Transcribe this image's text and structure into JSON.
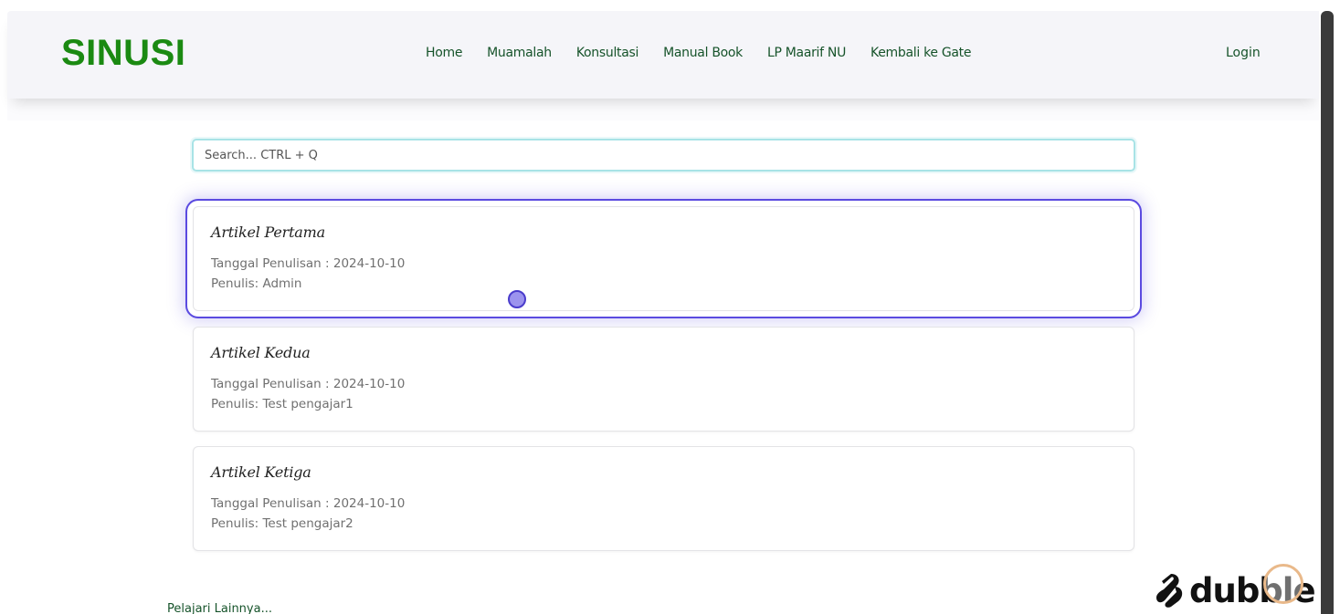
{
  "navbar": {
    "brand": "SINUSI",
    "links": [
      {
        "label": "Home"
      },
      {
        "label": "Muamalah"
      },
      {
        "label": "Konsultasi"
      },
      {
        "label": "Manual Book"
      },
      {
        "label": "LP Maarif NU"
      },
      {
        "label": "Kembali ke Gate"
      }
    ],
    "login_label": "Login"
  },
  "search": {
    "placeholder": "Search... CTRL + Q",
    "value": ""
  },
  "articles": [
    {
      "title": "Artikel Pertama",
      "date": "Tanggal Penulisan : 2024-10-10",
      "author": "Penulis: Admin"
    },
    {
      "title": "Artikel Kedua",
      "date": "Tanggal Penulisan : 2024-10-10",
      "author": "Penulis: Test pengajar1"
    },
    {
      "title": "Artikel Ketiga",
      "date": "Tanggal Penulisan : 2024-10-10",
      "author": "Penulis: Test pengajar2"
    }
  ],
  "more_link": "Pelajari Lainnya...",
  "watermark": {
    "text": "dubble",
    "icon": "dubble-logo-icon"
  },
  "colors": {
    "brand": "#1b8a12",
    "nav_text": "#16532a",
    "highlight": "#5a4ae0",
    "navbar_bg": "#f5f5f9"
  }
}
